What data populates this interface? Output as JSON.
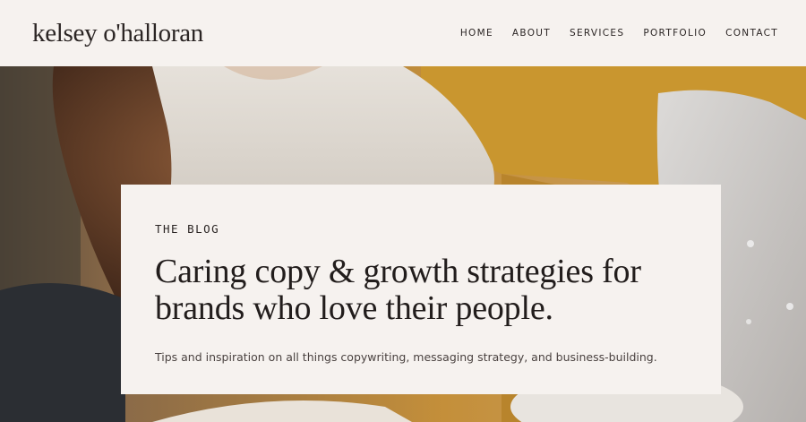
{
  "header": {
    "logo": "kelsey o'halloran",
    "nav": [
      "HOME",
      "ABOUT",
      "SERVICES",
      "PORTFOLIO",
      "CONTACT"
    ]
  },
  "hero": {
    "eyebrow": "THE BLOG",
    "headline_line1": "Caring copy & growth strategies for",
    "headline_line2": "brands who love their people.",
    "subtext": "Tips and inspiration on all things copywriting, messaging strategy, and business-building."
  },
  "colors": {
    "background": "#f6f2ef",
    "text": "#2b2524",
    "sofa_mustard": "#c9962f",
    "sweater_cream": "#d9d3cb"
  }
}
